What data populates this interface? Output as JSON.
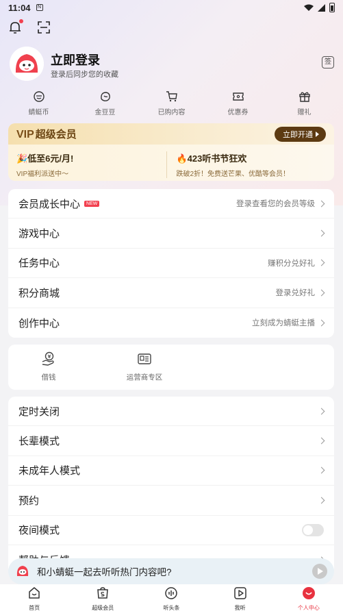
{
  "status_bar": {
    "time": "11:04",
    "nfc": "N"
  },
  "profile": {
    "title": "立即登录",
    "subtitle": "登录后同步您的收藏",
    "sign_label": "签"
  },
  "quick_links": [
    {
      "label": "蜻蜓币",
      "icon": "coin-icon"
    },
    {
      "label": "金豆豆",
      "icon": "bean-icon"
    },
    {
      "label": "已购内容",
      "icon": "cart-icon"
    },
    {
      "label": "优惠券",
      "icon": "ticket-icon"
    },
    {
      "label": "赠礼",
      "icon": "gift-icon"
    }
  ],
  "vip": {
    "badge": "VIP",
    "title": "超级会员",
    "button": "立即开通",
    "left_title": "🎉低至6元/月!",
    "left_sub": "VIP福利派送中～",
    "right_title": "🔥423听书节狂欢",
    "right_sub": "跌破2折！免费送芒果、优酷等会员！"
  },
  "menu_main": [
    {
      "label": "会员成长中心",
      "badge": "NEW",
      "hint": "登录查看您的会员等级"
    },
    {
      "label": "游戏中心",
      "hint": ""
    },
    {
      "label": "任务中心",
      "hint": "赚积分兑好礼"
    },
    {
      "label": "积分商城",
      "hint": "登录兑好礼"
    },
    {
      "label": "创作中心",
      "hint": "立刻成为蜻蜓主播"
    }
  ],
  "tools": [
    {
      "label": "借钱",
      "icon": "loan-icon"
    },
    {
      "label": "运营商专区",
      "icon": "carrier-icon"
    }
  ],
  "menu_settings": [
    {
      "label": "定时关闭"
    },
    {
      "label": "长辈模式"
    },
    {
      "label": "未成年人模式"
    },
    {
      "label": "预约"
    },
    {
      "label": "夜间模式",
      "toggle": false
    },
    {
      "label": "帮助与反馈"
    }
  ],
  "mini_player": {
    "text": "和小蜻蜓一起去听听热门内容吧?"
  },
  "bottom_nav": [
    {
      "label": "首页",
      "icon": "home-icon",
      "active": false
    },
    {
      "label": "超级会员",
      "icon": "vip-bag-icon",
      "active": false
    },
    {
      "label": "听头条",
      "icon": "headline-icon",
      "active": false
    },
    {
      "label": "我听",
      "icon": "play-box-icon",
      "active": false
    },
    {
      "label": "个人中心",
      "icon": "profile-icon",
      "active": true
    }
  ],
  "colors": {
    "accent": "#e8323f",
    "vip_brown": "#5c3a12",
    "vip_gold": "#f5dfae"
  }
}
